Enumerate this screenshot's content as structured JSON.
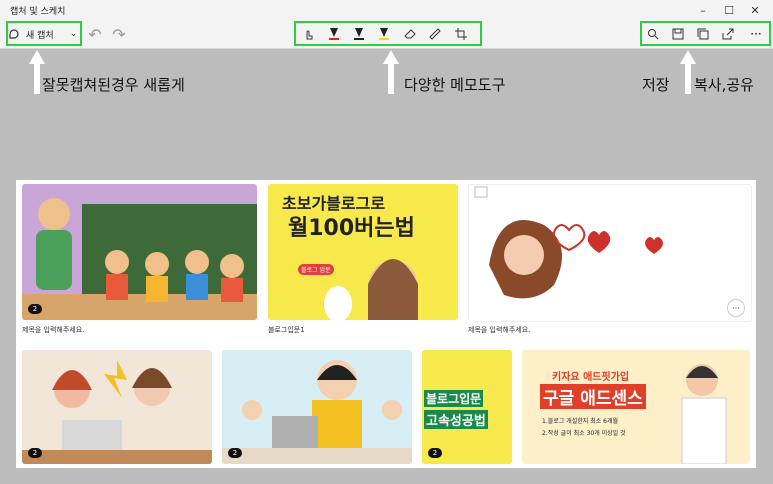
{
  "window": {
    "title": "캡처 및 스케치"
  },
  "toolbar": {
    "new_capture_label": "새 캡처",
    "icons": [
      "new-capture-icon",
      "chevron-down-icon",
      "undo-icon",
      "redo-icon",
      "touch-writing-icon",
      "ballpoint-pen-icon",
      "pencil-icon",
      "highlighter-icon",
      "eraser-icon",
      "ruler-icon",
      "crop-icon",
      "zoom-icon",
      "save-icon",
      "copy-icon",
      "share-icon",
      "more-icon"
    ]
  },
  "annotations": {
    "left": "잘못캡쳐된경우 새롭게",
    "middle": "다양한 메모도구",
    "save": "저장",
    "right": "복사,공유"
  },
  "cards": {
    "c1_caption": "제목을 입력해주세요.",
    "c2_caption": "블로그입문1",
    "c3_caption": "제목을 입력해주세요.",
    "c2_headline1": "초보가블로그로",
    "c2_headline2": "월100버는법",
    "c2_tag": "블로그 입문",
    "c6_text1": "블로그입문",
    "c6_text2": "고속성공법",
    "c7_title1": "키자요 애드핏가입",
    "c7_title2": "구글 애드센스",
    "c7_line1": "1.블로그 개설한지 최소 6개월",
    "c7_line2": "2.작성 글이 최소 30개 이상일 것",
    "badge": "2",
    "more": "···"
  },
  "colors": {
    "highlight": "#2ecc40",
    "pen_red": "#e0202e",
    "highlighter_yellow": "#f2d431"
  }
}
